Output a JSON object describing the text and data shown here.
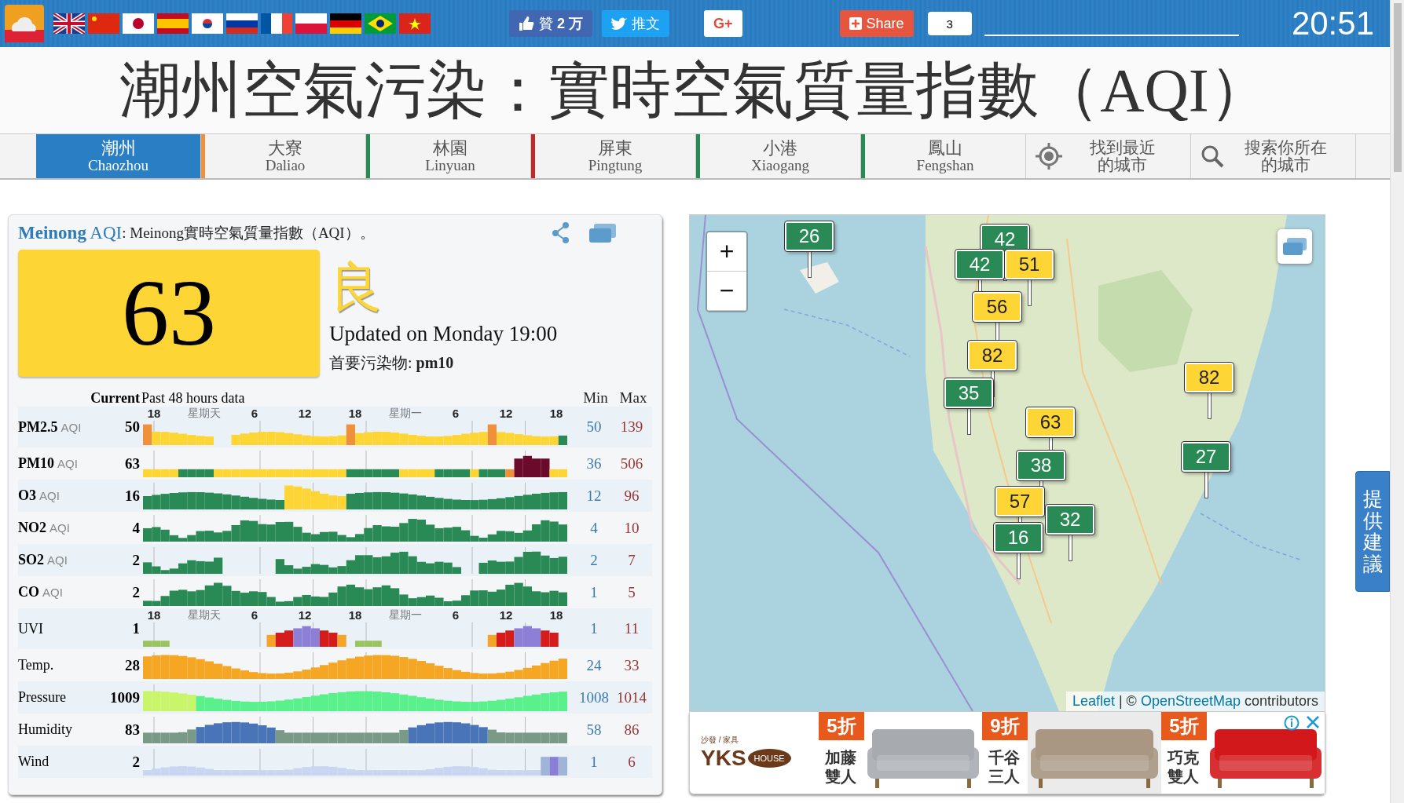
{
  "top_bar": {
    "like_button": "贊 **2 万**",
    "tweet_button": "推文",
    "gplus_button": "G+",
    "share_button": "Share",
    "share_count": "3",
    "time": "20:51"
  },
  "title": "潮州空氣污染：實時空氣質量指數（AQI）",
  "tabs": [
    {
      "name": "潮州",
      "latin": "Chaozhou",
      "selected": true
    },
    {
      "name": "大寮",
      "latin": "Daliao",
      "selected": false,
      "color": "#f0903a"
    },
    {
      "name": "林園",
      "latin": "Linyuan",
      "selected": false,
      "color": "#2a8a55"
    },
    {
      "name": "屏東",
      "latin": "Pingtung",
      "selected": false,
      "color": "#c0282e"
    },
    {
      "name": "小港",
      "latin": "Xiaogang",
      "selected": false,
      "color": "#2a8a55"
    },
    {
      "name": "鳳山",
      "latin": "Fengshan",
      "selected": false,
      "color": "#2a8a55"
    }
  ],
  "tool_tabs": [
    {
      "kind": "locate",
      "lines": [
        "找到最近",
        "的城市"
      ]
    },
    {
      "kind": "search",
      "lines": [
        "搜索你所在",
        "的城市"
      ]
    }
  ],
  "station": {
    "name": "**Meinong** AQI",
    "description": ": Meinong實時空氣質量指數（AQI）。",
    "aqi": "63",
    "color": "#fdd535",
    "level_text": "良",
    "updated": "Updated on Monday 19:00",
    "pollutant": "首要污染物: **pm10**"
  },
  "history": {
    "columns": [
      "Current",
      "Past 48 hours data",
      "Min",
      "Max"
    ],
    "rows": [
      {
        "name": "PM2.5",
        "unit": "AQI",
        "kind": "pm25",
        "current": "50",
        "min": "50",
        "max": "139",
        "ticks": [
          "18",
          "星期天",
          "6",
          "12",
          "18",
          "星期一",
          "6",
          "12",
          "18"
        ]
      },
      {
        "name": "PM10",
        "unit": "AQI",
        "kind": "pm10",
        "current": "63",
        "min": "36",
        "max": "506"
      },
      {
        "name": "O3",
        "unit": "AQI",
        "kind": "o3",
        "current": "16",
        "min": "12",
        "max": "96"
      },
      {
        "name": "NO2",
        "unit": "AQI",
        "kind": "green",
        "current": "4",
        "min": "4",
        "max": "10"
      },
      {
        "name": "SO2",
        "unit": "AQI",
        "kind": "so2",
        "current": "2",
        "min": "2",
        "max": "7"
      },
      {
        "name": "CO",
        "unit": "AQI",
        "kind": "green",
        "current": "2",
        "min": "1",
        "max": "5"
      },
      {
        "name": "UVI",
        "kind": "uvi",
        "current": "1",
        "min": "1",
        "max": "11",
        "ticks": [
          "18",
          "星期天",
          "6",
          "12",
          "18",
          "星期一",
          "6",
          "12",
          "18"
        ]
      },
      {
        "name": "Temp.",
        "kind": "temp",
        "current": "28",
        "min": "24",
        "max": "33"
      },
      {
        "name": "Pressure",
        "kind": "pressure",
        "current": "1009",
        "min": "1008",
        "max": "1014"
      },
      {
        "name": "Humidity",
        "kind": "humidity",
        "current": "83",
        "min": "58",
        "max": "86"
      },
      {
        "name": "Wind",
        "kind": "wind",
        "current": "2",
        "min": "1",
        "max": "6"
      }
    ]
  },
  "map": {
    "zoom_in": "+",
    "zoom_out": "−",
    "markers": [
      {
        "value": "26",
        "color": "#2a8a55"
      },
      {
        "value": "42",
        "color": "#2a8a55"
      },
      {
        "value": "42",
        "color": "#2a8a55"
      },
      {
        "value": "51",
        "color": "#fdd535"
      },
      {
        "value": "56",
        "color": "#fdd535"
      },
      {
        "value": "82",
        "color": "#fdd535"
      },
      {
        "value": "35",
        "color": "#2a8a55"
      },
      {
        "value": "63",
        "color": "#fdd535"
      },
      {
        "value": "82",
        "color": "#fdd535"
      },
      {
        "value": "27",
        "color": "#2a8a55"
      },
      {
        "value": "38",
        "color": "#2a8a55"
      },
      {
        "value": "57",
        "color": "#fdd535"
      },
      {
        "value": "32",
        "color": "#2a8a55"
      },
      {
        "value": "16",
        "color": "#2a8a55"
      }
    ],
    "attribution": {
      "leaflet": "Leaflet",
      "separator": " | © ",
      "osm": "OpenStreetMap",
      "rest": " contributors"
    }
  },
  "ad": {
    "logo_top": "沙發 / 家具",
    "logo_main": "YKS",
    "logo_bubble": "HOUSE",
    "offers": [
      {
        "discount": "5折",
        "lines": [
          "加藤",
          "雙人"
        ]
      },
      {
        "discount": "9折",
        "lines": [
          "千谷",
          "三人"
        ]
      },
      {
        "discount": "5折",
        "lines": [
          "巧克",
          "雙人"
        ]
      }
    ]
  },
  "feedback_button": "提供建議"
}
